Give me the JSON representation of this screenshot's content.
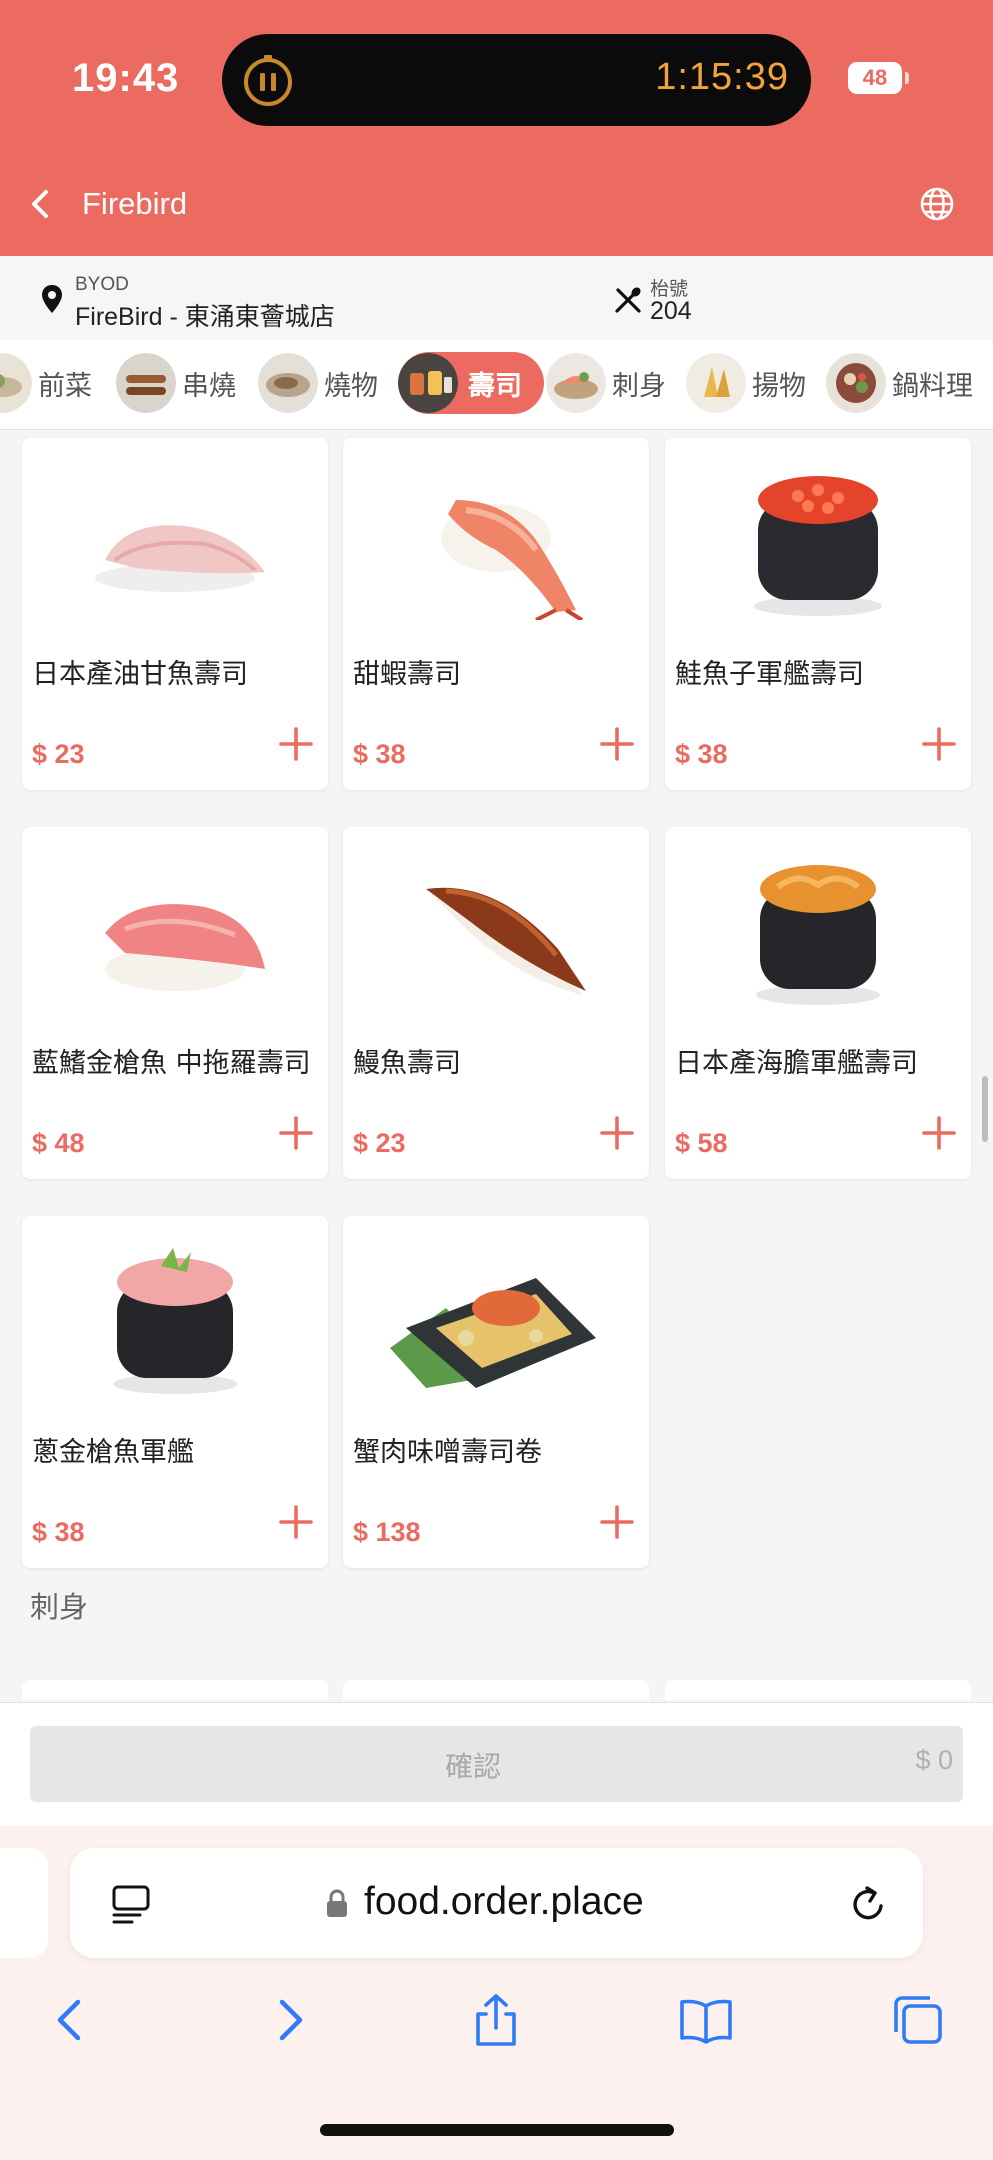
{
  "status_bar": {
    "time": "19:43",
    "timer": "1:15:39",
    "battery": "48"
  },
  "header": {
    "title": "Firebird"
  },
  "store_info": {
    "type_label": "BYOD",
    "store_name": "FireBird - 東涌東薈城店",
    "table_label": "枱號",
    "table_number": "204"
  },
  "categories": [
    {
      "label": "前菜",
      "active": false
    },
    {
      "label": "串燒",
      "active": false
    },
    {
      "label": "燒物",
      "active": false
    },
    {
      "label": "壽司",
      "active": true
    },
    {
      "label": "刺身",
      "active": false
    },
    {
      "label": "揚物",
      "active": false
    },
    {
      "label": "鍋料理",
      "active": false
    }
  ],
  "products": [
    {
      "name": "日本產油甘魚壽司",
      "price": "$ 23"
    },
    {
      "name": "甜蝦壽司",
      "price": "$ 38"
    },
    {
      "name": "鮭魚子軍艦壽司",
      "price": "$ 38"
    },
    {
      "name": "藍鰭金槍魚 中拖羅壽司",
      "price": "$ 48"
    },
    {
      "name": "鰻魚壽司",
      "price": "$ 23"
    },
    {
      "name": "日本產海膽軍艦壽司",
      "price": "$ 58"
    },
    {
      "name": "蔥金槍魚軍艦",
      "price": "$ 38"
    },
    {
      "name": "蟹肉味噌壽司卷",
      "price": "$ 138"
    }
  ],
  "next_section": {
    "title": "刺身"
  },
  "confirm_bar": {
    "label": "確認",
    "total": "$ 0"
  },
  "browser": {
    "url": "food.order.place"
  },
  "colors": {
    "brand": "#eb6b61",
    "island_text": "#f2a43a",
    "safari_blue": "#2f7cf6"
  }
}
